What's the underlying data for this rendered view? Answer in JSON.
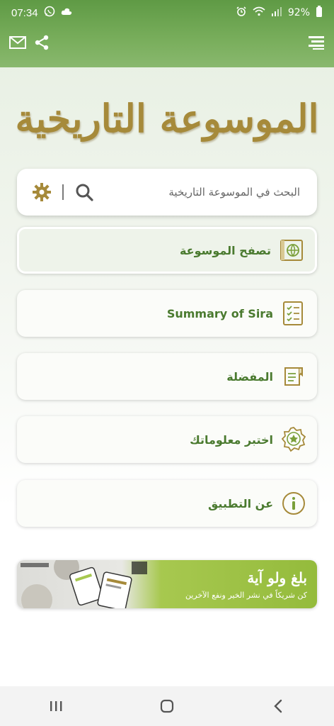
{
  "status": {
    "time": "07:34",
    "battery": "92%",
    "icons": [
      "whatsapp-icon",
      "cloud-icon",
      "alarm-icon",
      "wifi-icon",
      "signal-icon",
      "battery-icon"
    ]
  },
  "toolbar": {
    "left_icons": [
      "mail-icon",
      "share-icon"
    ],
    "right_icon": "menu-icon"
  },
  "logo": {
    "text": "الموسوعة التاريخية"
  },
  "search": {
    "placeholder": "البحث في الموسوعة التاريخية"
  },
  "menu": {
    "items": [
      {
        "label": "تصفح الموسوعة",
        "icon": "globe-book-icon"
      },
      {
        "label": "Summary of Sira",
        "icon": "checklist-icon"
      },
      {
        "label": "المفضلة",
        "icon": "bookmark-icon"
      },
      {
        "label": "اختبر معلوماتك",
        "icon": "badge-star-icon"
      },
      {
        "label": "عن التطبيق",
        "icon": "info-icon"
      }
    ]
  },
  "banner": {
    "title": "بلغ ولو آية",
    "subtitle": "كن شريكاً في نشر الخير ونفع الآخرين"
  },
  "colors": {
    "primary_green": "#6aa24e",
    "label_green": "#4a7a2f",
    "gold": "#a68a3a"
  },
  "navbar": {
    "icons": [
      "recent-apps-icon",
      "home-icon",
      "back-icon"
    ]
  }
}
